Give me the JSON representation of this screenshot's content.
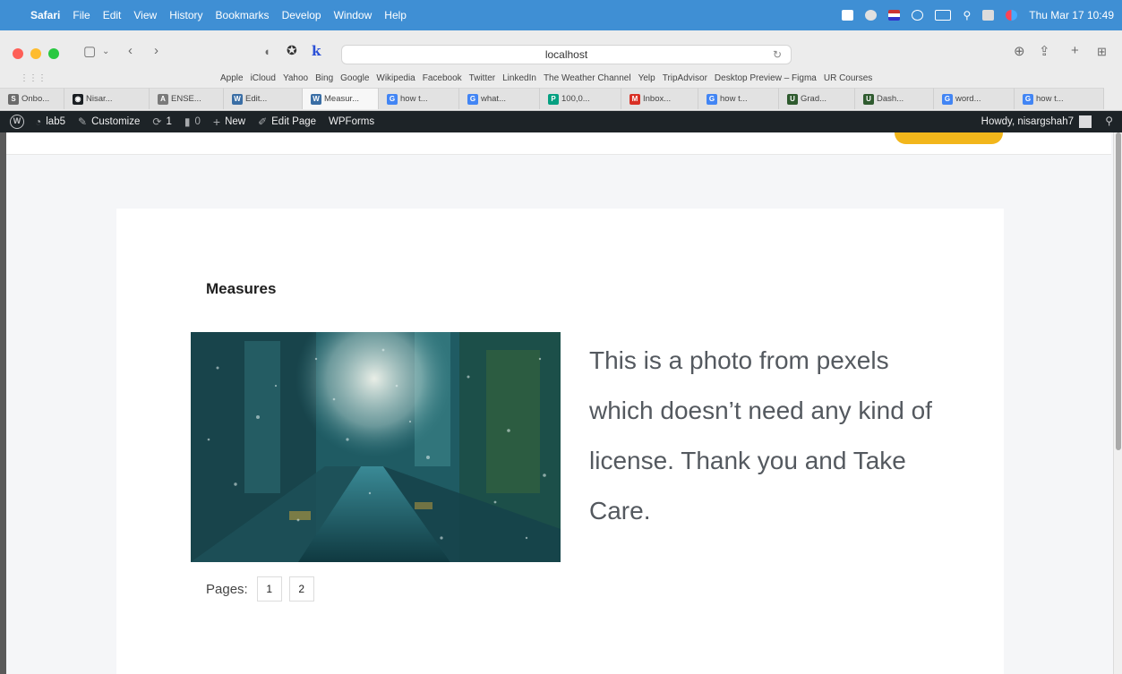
{
  "menubar": {
    "app": "Safari",
    "items": [
      "File",
      "Edit",
      "View",
      "History",
      "Bookmarks",
      "Develop",
      "Window",
      "Help"
    ],
    "clock": "Thu Mar 17  10:49"
  },
  "browser": {
    "address": "localhost",
    "favorites": [
      "Apple",
      "iCloud",
      "Yahoo",
      "Bing",
      "Google",
      "Wikipedia",
      "Facebook",
      "Twitter",
      "LinkedIn",
      "The Weather Channel",
      "Yelp",
      "TripAdvisor",
      "Desktop Preview – Figma",
      "UR Courses"
    ],
    "tabs": [
      {
        "label": "Onbo...",
        "icon": "S",
        "color": "#6b6b6b"
      },
      {
        "label": "Nisar...",
        "icon": "◉",
        "color": "#1b1f23"
      },
      {
        "label": "ENSE...",
        "icon": "A",
        "color": "#7a7a7a"
      },
      {
        "label": "Edit...",
        "icon": "W",
        "color": "#3a6ea5"
      },
      {
        "label": "Measur...",
        "icon": "W",
        "color": "#3a6ea5"
      },
      {
        "label": "how t...",
        "icon": "G",
        "color": "#4285f4"
      },
      {
        "label": "what...",
        "icon": "G",
        "color": "#4285f4"
      },
      {
        "label": "100,0...",
        "icon": "P",
        "color": "#05a081"
      },
      {
        "label": "Inbox...",
        "icon": "M",
        "color": "#d93025"
      },
      {
        "label": "how t...",
        "icon": "G",
        "color": "#4285f4"
      },
      {
        "label": "Grad...",
        "icon": "U",
        "color": "#2f5b2f"
      },
      {
        "label": "Dash...",
        "icon": "U",
        "color": "#2f5b2f"
      },
      {
        "label": "word...",
        "icon": "G",
        "color": "#4285f4"
      },
      {
        "label": "how t...",
        "icon": "G",
        "color": "#4285f4"
      }
    ]
  },
  "wpbar": {
    "site": "lab5",
    "customize": "Customize",
    "updates": "1",
    "comments": "0",
    "new": "New",
    "edit_page": "Edit Page",
    "forms": "WPForms",
    "howdy": "Howdy, nisargshah7"
  },
  "post": {
    "title": "Measures",
    "body": "This is a photo from pexels which doesn’t need any kind of license. Thank you and Take Care.",
    "pages_label": "Pages:",
    "pages": [
      "1",
      "2"
    ]
  }
}
